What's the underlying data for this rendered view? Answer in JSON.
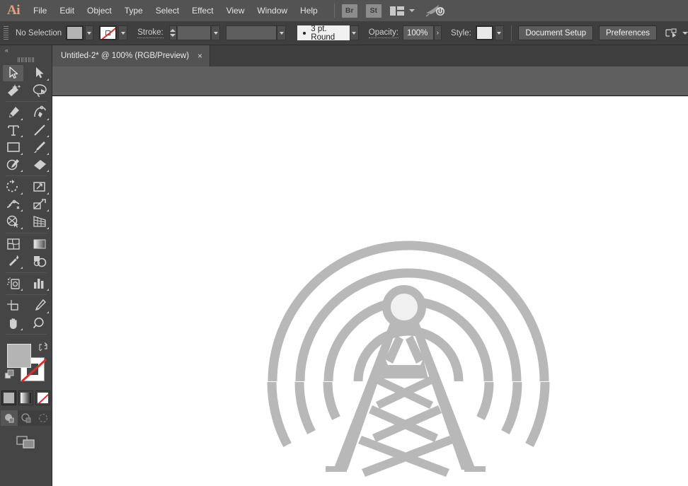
{
  "app": {
    "name": "Adobe Illustrator",
    "logo_text": "Ai"
  },
  "menubar": {
    "items": [
      {
        "label": "File"
      },
      {
        "label": "Edit"
      },
      {
        "label": "Object"
      },
      {
        "label": "Type"
      },
      {
        "label": "Select"
      },
      {
        "label": "Effect"
      },
      {
        "label": "View"
      },
      {
        "label": "Window"
      },
      {
        "label": "Help"
      }
    ],
    "bridge_label": "Br",
    "stock_label": "St",
    "workspace_icon": "workspace-switcher-icon",
    "search_icon": "discover-rocket-icon"
  },
  "control_bar": {
    "selection_status": "No Selection",
    "fill_swatch": {
      "name": "fill-color",
      "color": "#b4b4b4"
    },
    "stroke_swatch": {
      "name": "stroke-color",
      "color": "none"
    },
    "stroke_label": "Stroke:",
    "stroke_weight": "",
    "stroke_profile": "",
    "brush_definition": "3 pt. Round",
    "opacity_label": "Opacity:",
    "opacity_value": "100%",
    "style_label": "Style:",
    "style_swatch_color": "#e8e8e8",
    "document_setup_label": "Document Setup",
    "preferences_label": "Preferences",
    "align_icon": "align-to-selection-icon"
  },
  "tabs": {
    "documents": [
      {
        "title": "Untitled-2* @ 100% (RGB/Preview)",
        "close_label": "×",
        "active": true
      }
    ]
  },
  "toolbar": {
    "collapse_label": "«",
    "tools": [
      {
        "name": "selection-tool",
        "label": "Selection",
        "active": true,
        "has_flyout": false
      },
      {
        "name": "direct-selection-tool",
        "label": "Direct Selection",
        "active": false,
        "has_flyout": true
      },
      {
        "name": "magic-wand-tool",
        "label": "Magic Wand",
        "active": false,
        "has_flyout": false
      },
      {
        "name": "lasso-tool",
        "label": "Lasso",
        "active": false,
        "has_flyout": false
      },
      {
        "name": "pen-tool",
        "label": "Pen",
        "active": false,
        "has_flyout": true
      },
      {
        "name": "curvature-tool",
        "label": "Curvature",
        "active": false,
        "has_flyout": true
      },
      {
        "name": "type-tool",
        "label": "Type",
        "active": false,
        "has_flyout": true
      },
      {
        "name": "line-segment-tool",
        "label": "Line Segment",
        "active": false,
        "has_flyout": true
      },
      {
        "name": "rectangle-tool",
        "label": "Rectangle",
        "active": false,
        "has_flyout": true
      },
      {
        "name": "paintbrush-tool",
        "label": "Paintbrush",
        "active": false,
        "has_flyout": true
      },
      {
        "name": "shaper-tool",
        "label": "Shaper",
        "active": false,
        "has_flyout": true
      },
      {
        "name": "eraser-tool",
        "label": "Eraser",
        "active": false,
        "has_flyout": true
      },
      {
        "name": "rotate-tool",
        "label": "Rotate",
        "active": false,
        "has_flyout": true
      },
      {
        "name": "scale-tool",
        "label": "Scale",
        "active": false,
        "has_flyout": true
      },
      {
        "name": "width-tool",
        "label": "Width",
        "active": false,
        "has_flyout": true
      },
      {
        "name": "free-transform-tool",
        "label": "Free Transform",
        "active": false,
        "has_flyout": true
      },
      {
        "name": "shape-builder-tool",
        "label": "Shape Builder",
        "active": false,
        "has_flyout": true
      },
      {
        "name": "perspective-grid-tool",
        "label": "Perspective Grid",
        "active": false,
        "has_flyout": true
      },
      {
        "name": "mesh-tool",
        "label": "Mesh",
        "active": false,
        "has_flyout": false
      },
      {
        "name": "gradient-tool",
        "label": "Gradient",
        "active": false,
        "has_flyout": false
      },
      {
        "name": "eyedropper-tool",
        "label": "Eyedropper",
        "active": false,
        "has_flyout": true
      },
      {
        "name": "blend-tool",
        "label": "Blend",
        "active": false,
        "has_flyout": false
      },
      {
        "name": "symbol-sprayer-tool",
        "label": "Symbol Sprayer",
        "active": false,
        "has_flyout": true
      },
      {
        "name": "column-graph-tool",
        "label": "Column Graph",
        "active": false,
        "has_flyout": true
      },
      {
        "name": "artboard-tool",
        "label": "Artboard",
        "active": false,
        "has_flyout": false
      },
      {
        "name": "slice-tool",
        "label": "Slice",
        "active": false,
        "has_flyout": true
      },
      {
        "name": "hand-tool",
        "label": "Hand",
        "active": false,
        "has_flyout": true
      },
      {
        "name": "zoom-tool",
        "label": "Zoom",
        "active": false,
        "has_flyout": false
      }
    ],
    "fill_color": "#b4b4b4",
    "stroke_color": "none",
    "color_modes": [
      {
        "name": "color-mode-color",
        "selected": true
      },
      {
        "name": "color-mode-gradient",
        "selected": false
      },
      {
        "name": "color-mode-none",
        "selected": false
      }
    ],
    "draw_modes": [
      {
        "name": "draw-normal-mode",
        "selected": true
      },
      {
        "name": "draw-behind-mode",
        "selected": false
      },
      {
        "name": "draw-inside-mode",
        "selected": false
      }
    ],
    "screen_mode": "change-screen-mode-icon"
  },
  "artwork": {
    "name": "radio-tower-antenna-illustration",
    "fill_color": "#b8b8b8",
    "emitter_center_color": "#f0f0f0",
    "description": "Radio transmission tower with four concentric signal arcs",
    "signal_arcs": 4,
    "canvas_background": "#ffffff"
  }
}
